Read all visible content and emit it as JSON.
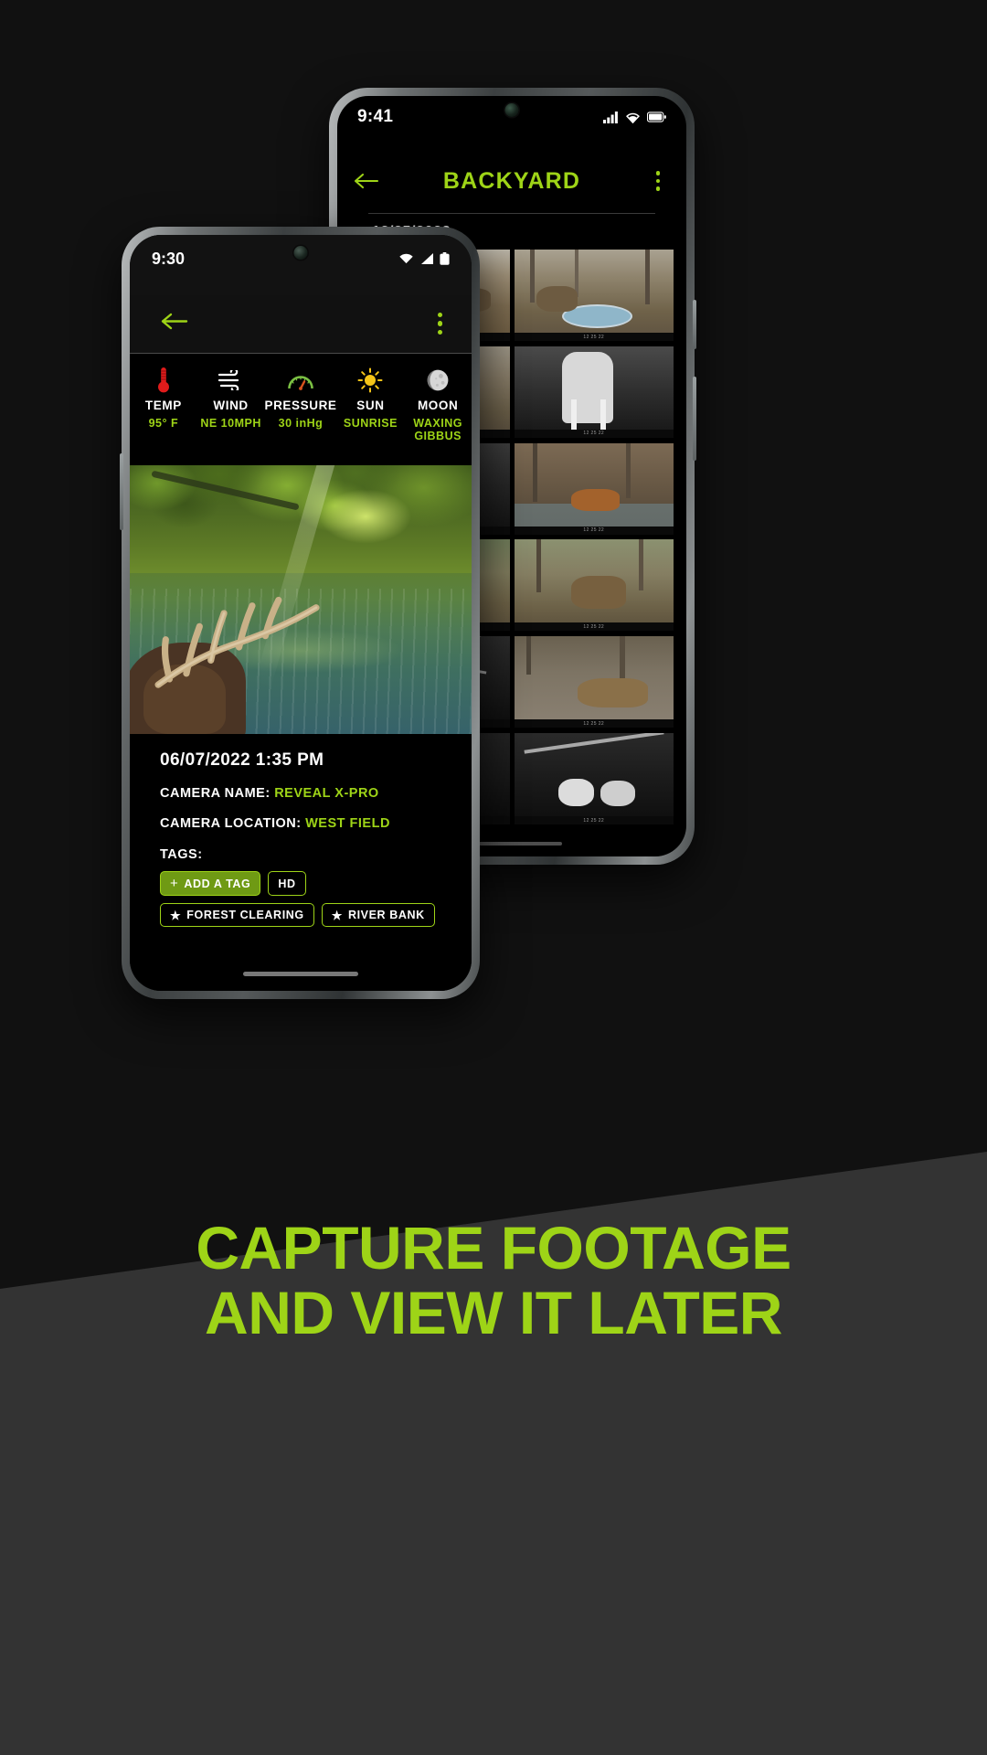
{
  "marketing": {
    "headline_line1": "CAPTURE FOOTAGE",
    "headline_line2": "AND VIEW IT LATER",
    "accent_color": "#9ed417",
    "band_color": "#333333",
    "page_background": "#111111"
  },
  "back_phone": {
    "status_bar": {
      "time": "9:41",
      "icons": [
        "cellular-signal-icon",
        "wifi-icon",
        "battery-icon"
      ]
    },
    "app_bar": {
      "back_label": "back-arrow",
      "title": "BACKYARD",
      "overflow_label": "more-options"
    },
    "gallery": {
      "date_label": "12/25/2022",
      "thumbnails": [
        {
          "caption": "deer standing in leaf-covered woods",
          "info": "12  25  22"
        },
        {
          "caption": "deer drinking from water trough",
          "info": "12  25  22"
        },
        {
          "caption": "deer beside water trough in woods",
          "info": "12  25  22"
        },
        {
          "caption": "night infrared deer legs close-up",
          "info": "12  25  22"
        },
        {
          "caption": "night infrared white deer tail",
          "info": "12  25  22"
        },
        {
          "caption": "fox walking in flooded woods",
          "info": "12  25  22"
        },
        {
          "caption": "buck on a forest trail",
          "info": "12  25  22"
        },
        {
          "caption": "doe standing on dirt path",
          "info": "12  25  22"
        },
        {
          "caption": "night infrared deer under branches",
          "info": "12  25  22"
        },
        {
          "caption": "deer bedded on gravel clearing",
          "info": "12  25  22"
        },
        {
          "caption": "night infrared woods with tree",
          "info": "12  25  22"
        },
        {
          "caption": "two fawns at night in clearing",
          "info": "12  25  22"
        }
      ]
    }
  },
  "front_phone": {
    "status_bar": {
      "time": "9:30",
      "icons": [
        "wifi-icon",
        "cellular-signal-icon",
        "battery-icon"
      ]
    },
    "app_bar": {
      "back_label": "back-arrow",
      "overflow_label": "more-options"
    },
    "weather": [
      {
        "icon": "thermometer-icon",
        "label": "TEMP",
        "value": "95° F"
      },
      {
        "icon": "wind-icon",
        "label": "WIND",
        "value": "NE 10MPH"
      },
      {
        "icon": "pressure-gauge-icon",
        "label": "PRESSURE",
        "value": "30 inHg"
      },
      {
        "icon": "sun-icon",
        "label": "SUN",
        "value": "SUNRISE"
      },
      {
        "icon": "moon-icon",
        "label": "MOON",
        "value": "WAXING GIBBUS"
      }
    ],
    "photo": {
      "caption": "buck with large antlers standing in a green creek"
    },
    "detail": {
      "timestamp": "06/07/2022 1:35 PM",
      "camera_name_label": "CAMERA NAME:",
      "camera_name_value": "REVEAL X-PRO",
      "camera_location_label": "CAMERA LOCATION:",
      "camera_location_value": "WEST FIELD",
      "tags_label": "TAGS:",
      "tags": [
        {
          "text": "ADD A TAG",
          "icon": "plus-icon",
          "style": "filled"
        },
        {
          "text": "HD",
          "icon": "none",
          "style": "outline"
        },
        {
          "text": "FOREST CLEARING",
          "icon": "star-icon",
          "style": "outline"
        },
        {
          "text": "RIVER BANK",
          "icon": "star-icon",
          "style": "outline"
        }
      ]
    }
  }
}
